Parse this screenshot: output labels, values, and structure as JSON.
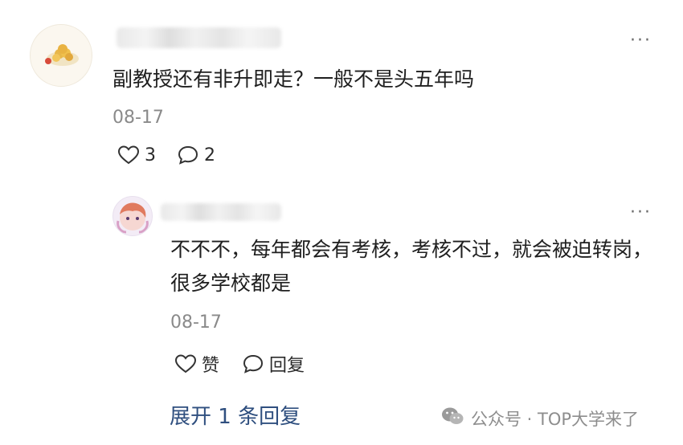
{
  "comments": [
    {
      "text": "副教授还有非升即走？一般不是头五年吗",
      "date": "08-17",
      "like_count": "3",
      "comment_count": "2",
      "more_label": "···"
    },
    {
      "text": "不不不，每年都会有考核，考核不过，就会被迫转岗，很多学校都是",
      "date": "08-17",
      "like_label": "赞",
      "reply_label": "回复",
      "more_label": "···"
    }
  ],
  "expand_label": "展开 1 条回复",
  "watermark": "公众号 · TOP大学来了",
  "colors": {
    "link": "#2f4f7f",
    "date": "#8a8a8a",
    "watermark": "#8d8d8d"
  },
  "icons": [
    "heart-icon",
    "comment-bubble-icon",
    "wechat-icon"
  ]
}
